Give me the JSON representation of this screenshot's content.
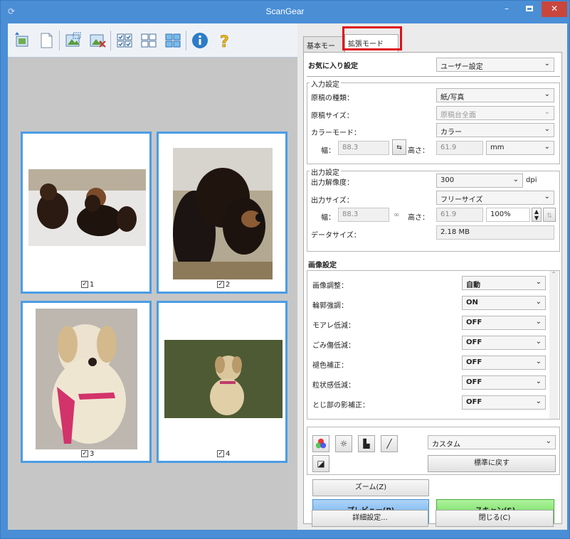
{
  "window": {
    "title": "ScanGear",
    "minimize": "–",
    "close": "✕"
  },
  "tabs": {
    "basic": "基本モード",
    "advanced": "拡張モード"
  },
  "favorites": {
    "label": "お気に入り設定",
    "value": "ユーザー設定"
  },
  "input": {
    "title": "入力設定",
    "doc_type_label": "原稿の種類：",
    "doc_type": "紙/写真",
    "doc_size_label": "原稿サイズ：",
    "doc_size": "原稿台全面",
    "color_mode_label": "カラーモード：",
    "color_mode": "カラー",
    "width_label": "幅：",
    "width": "88.3",
    "height_label": "高さ：",
    "height": "61.9",
    "unit": "mm"
  },
  "output": {
    "title": "出力設定",
    "resolution_label": "出力解像度：",
    "resolution": "300",
    "dpi": "dpi",
    "size_label": "出力サイズ：",
    "size": "フリーサイズ",
    "width_label": "幅：",
    "width": "88.3",
    "height_label": "高さ：",
    "height": "61.9",
    "scale": "100%",
    "data_size_label": "データサイズ：",
    "data_size": "2.18 MB"
  },
  "image": {
    "title": "画像設定",
    "rows": [
      {
        "label": "画像調整：",
        "value": "自動"
      },
      {
        "label": "輪郭強調：",
        "value": "ON"
      },
      {
        "label": "モアレ低減：",
        "value": "OFF"
      },
      {
        "label": "ごみ傷低減：",
        "value": "OFF"
      },
      {
        "label": "褪色補正：",
        "value": "OFF"
      },
      {
        "label": "粒状感低減：",
        "value": "OFF"
      },
      {
        "label": "とじ部の影補正：",
        "value": "OFF"
      }
    ]
  },
  "color_adjust": {
    "preset": "カスタム",
    "reset": "標準に戻す"
  },
  "buttons": {
    "zoom": "ズーム(Z)",
    "preview": "プレビュー(P)",
    "scan": "スキャン(S)",
    "preferences": "詳細設定...",
    "close": "閉じる(C)"
  },
  "thumbs": [
    {
      "label": "1"
    },
    {
      "label": "2"
    },
    {
      "label": "3"
    },
    {
      "label": "4"
    }
  ]
}
